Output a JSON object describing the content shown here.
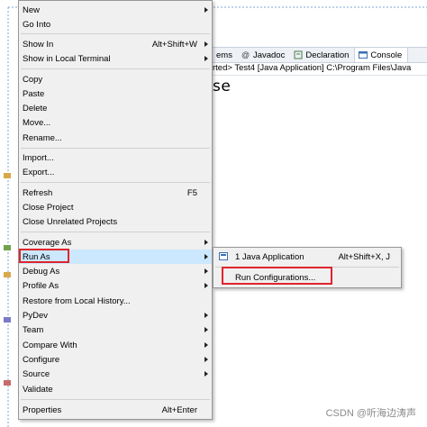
{
  "background": {
    "tabs": [
      {
        "label": "ems",
        "icon": "none"
      },
      {
        "label": "Javadoc",
        "icon": "at-icon"
      },
      {
        "label": "Declaration",
        "icon": "declaration-icon"
      },
      {
        "label": "Console",
        "icon": "console-icon",
        "active": true
      }
    ],
    "console_line": "rted> Test4 [Java Application] C:\\Program Files\\Java",
    "big_word": "se"
  },
  "menu": {
    "items": [
      {
        "label": "New",
        "accel": "",
        "submenu": true
      },
      {
        "label": "Go Into",
        "accel": "",
        "submenu": false
      },
      {
        "label": "Show In",
        "accel": "Alt+Shift+W",
        "submenu": true
      },
      {
        "label": "Show in Local Terminal",
        "accel": "",
        "submenu": true
      },
      {
        "label": "Copy",
        "accel": "",
        "submenu": false
      },
      {
        "label": "Paste",
        "accel": "",
        "submenu": false
      },
      {
        "label": "Delete",
        "accel": "",
        "submenu": false
      },
      {
        "label": "Move...",
        "accel": "",
        "submenu": false
      },
      {
        "label": "Rename...",
        "accel": "",
        "submenu": false
      },
      {
        "label": "Import...",
        "accel": "",
        "submenu": false
      },
      {
        "label": "Export...",
        "accel": "",
        "submenu": false
      },
      {
        "label": "Refresh",
        "accel": "F5",
        "submenu": false
      },
      {
        "label": "Close Project",
        "accel": "",
        "submenu": false
      },
      {
        "label": "Close Unrelated Projects",
        "accel": "",
        "submenu": false
      },
      {
        "label": "Coverage As",
        "accel": "",
        "submenu": true
      },
      {
        "label": "Run As",
        "accel": "",
        "submenu": true
      },
      {
        "label": "Debug As",
        "accel": "",
        "submenu": true
      },
      {
        "label": "Profile As",
        "accel": "",
        "submenu": true
      },
      {
        "label": "Restore from Local History...",
        "accel": "",
        "submenu": false
      },
      {
        "label": "PyDev",
        "accel": "",
        "submenu": true
      },
      {
        "label": "Team",
        "accel": "",
        "submenu": true
      },
      {
        "label": "Compare With",
        "accel": "",
        "submenu": true
      },
      {
        "label": "Configure",
        "accel": "",
        "submenu": true
      },
      {
        "label": "Source",
        "accel": "",
        "submenu": true
      },
      {
        "label": "Validate",
        "accel": "",
        "submenu": false
      },
      {
        "label": "Properties",
        "accel": "Alt+Enter",
        "submenu": false
      }
    ]
  },
  "submenu": {
    "items": [
      {
        "label": "1 Java Application",
        "accel": "Alt+Shift+X, J"
      },
      {
        "label": "Run Configurations...",
        "accel": ""
      }
    ]
  },
  "watermark": "CSDN @听海边涛声",
  "colors": {
    "highlight": "#cce8ff",
    "annotation_red": "#e0242d",
    "menu_bg": "#f0f0f0"
  }
}
